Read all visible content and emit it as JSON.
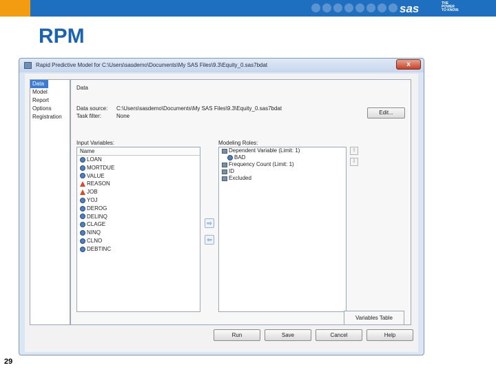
{
  "slide": {
    "title": "RPM",
    "number": "29",
    "logo": "sas",
    "tagline": [
      "THE",
      "POWER",
      "TO KNOW."
    ],
    "colors": {
      "band": "#1e6fc0",
      "accent": "#f39c12",
      "title": "#1a63b3"
    }
  },
  "window": {
    "title": "Rapid Predictive Model for C:\\Users\\sasdemo\\Documents\\My SAS Files\\9.3\\Equity_0.sas7bdat",
    "close_label": "x",
    "app_icon": "window-app-icon"
  },
  "nav": {
    "items": [
      "Data",
      "Model",
      "Report",
      "Options",
      "Registration"
    ],
    "selected": "Data"
  },
  "data_panel": {
    "heading": "Data",
    "data_source_label": "Data source:",
    "data_source_value": "C:\\Users\\sasdemo\\Documents\\My SAS Files\\9.3\\Equity_0.sas7bdat",
    "task_filter_label": "Task filter:",
    "task_filter_value": "None",
    "edit_label": "Edit...",
    "input_variables_label": "Input Variables:",
    "name_header": "Name",
    "variables": [
      {
        "name": "LOAN",
        "type": "numeric"
      },
      {
        "name": "MORTDUE",
        "type": "numeric"
      },
      {
        "name": "VALUE",
        "type": "numeric"
      },
      {
        "name": "REASON",
        "type": "character"
      },
      {
        "name": "JOB",
        "type": "character"
      },
      {
        "name": "YOJ",
        "type": "numeric"
      },
      {
        "name": "DEROG",
        "type": "numeric"
      },
      {
        "name": "DELINQ",
        "type": "numeric"
      },
      {
        "name": "CLAGE",
        "type": "numeric"
      },
      {
        "name": "NINQ",
        "type": "numeric"
      },
      {
        "name": "CLNO",
        "type": "numeric"
      },
      {
        "name": "DEBTINC",
        "type": "numeric"
      }
    ],
    "modeling_roles_label": "Modeling Roles:",
    "roles": [
      {
        "label": "Dependent Variable (Limit: 1)",
        "level": 0
      },
      {
        "label": "BAD",
        "level": 1
      },
      {
        "label": "Frequency Count (Limit: 1)",
        "level": 0
      },
      {
        "label": "ID",
        "level": 0
      },
      {
        "label": "Excluded",
        "level": 0
      }
    ],
    "move_right_label": "⇨",
    "move_left_label": "⇦",
    "up_label": "⇧",
    "down_label": "⇩",
    "variables_table_label": "Variables Table"
  },
  "buttons": {
    "run": "Run",
    "save": "Save",
    "cancel": "Cancel",
    "help": "Help"
  }
}
